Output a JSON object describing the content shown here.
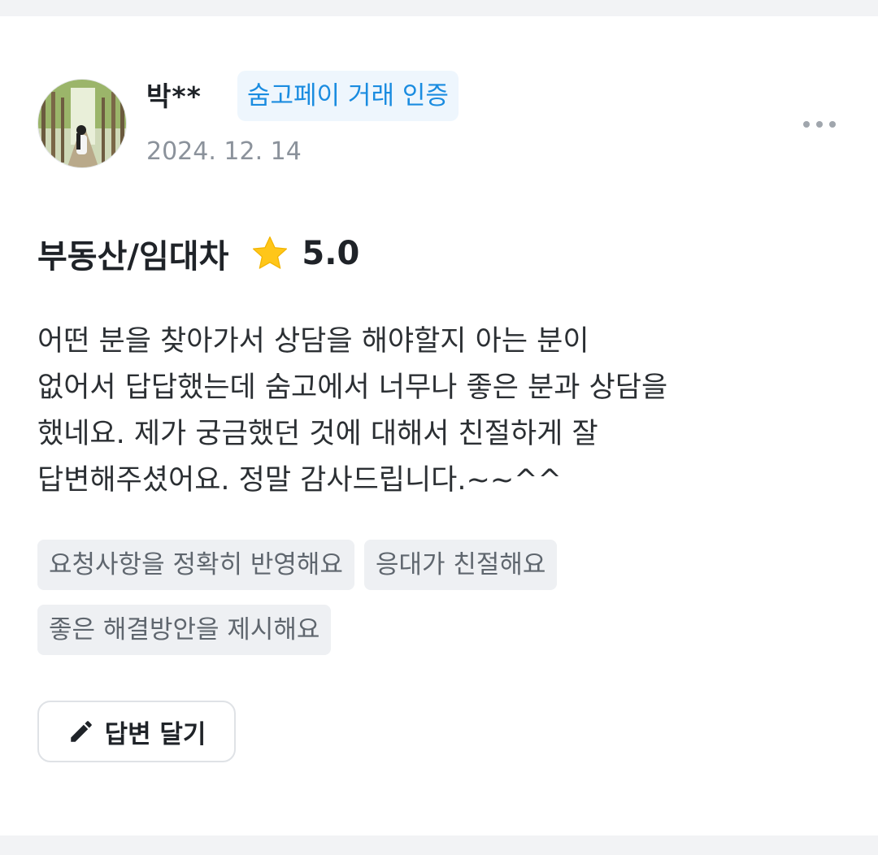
{
  "review": {
    "reviewer_name": "박**",
    "badge_label": "숨고페이 거래 인증",
    "date": "2024. 12. 14",
    "service": "부동산/임대차",
    "rating": "5.0",
    "rating_value": 5.0,
    "body_lines": [
      "어떤 분을 찾아가서 상담을 해야할지 아는 분이",
      "없어서 답답했는데 숨고에서 너무나 좋은 분과 상담을",
      "했네요. 제가 궁금했던 것에 대해서 친절하게 잘",
      "답변해주셨어요. 정말 감사드립니다.~~^^"
    ],
    "tags": [
      "요청사항을 정확히 반영해요",
      "응대가 친절해요",
      "좋은 해결방안을 제시해요"
    ],
    "reply_button_label": "답변 달기"
  },
  "icons": {
    "star": "star-icon",
    "pencil": "pencil-icon",
    "more": "more-dots-icon"
  },
  "colors": {
    "badge_text": "#1a8ce0",
    "badge_bg": "#eef6fd",
    "star": "#ffc619",
    "chip_bg": "#eef0f3"
  }
}
